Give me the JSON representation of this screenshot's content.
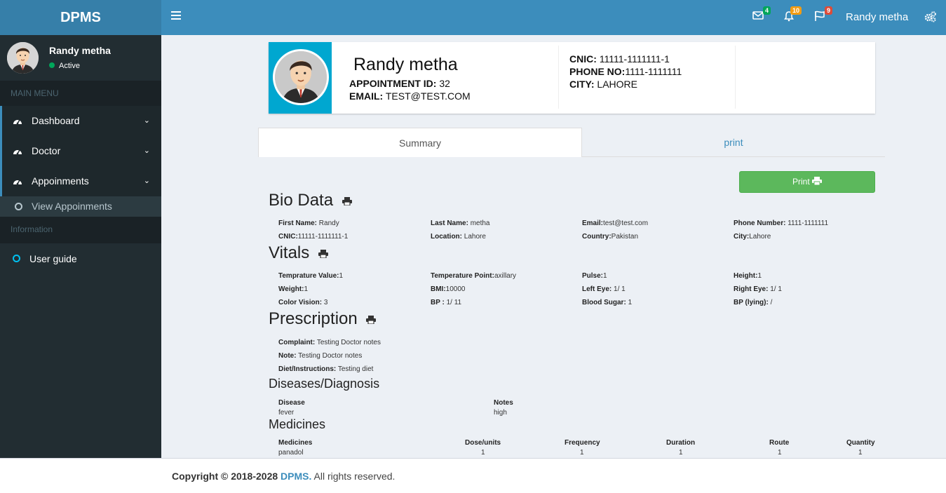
{
  "app": {
    "logo": "DPMS"
  },
  "topbar": {
    "messages_badge": "4",
    "notifications_badge": "10",
    "flags_badge": "9",
    "user_name": "Randy metha",
    "colors": {
      "bar": "#3c8dbc",
      "logo_bg": "#367fa9",
      "badge_green": "#00a65a",
      "badge_orange": "#f39c12",
      "badge_red": "#dd4b39"
    }
  },
  "sidebar": {
    "user_name": "Randy metha",
    "status": "Active",
    "main_header": "MAIN MENU",
    "items": [
      {
        "label": "Dashboard",
        "icon": "dashboard-icon"
      },
      {
        "label": "Doctor",
        "icon": "dashboard-icon"
      },
      {
        "label": "Appoinments",
        "icon": "dashboard-icon"
      }
    ],
    "sub_item": "View Appoinments",
    "info_header": "Information",
    "guide": "User guide"
  },
  "profile": {
    "name": "Randy metha",
    "appointment_label": "APPOINTMENT ID:",
    "appointment_id": "32",
    "email_label": "EMAIL:",
    "email": "TEST@TEST.COM",
    "cnic_label": "CNIC:",
    "cnic": "11111-1111111-1",
    "phone_label": "PHONE NO:",
    "phone": "1111-1111111",
    "city_label": "CITY:",
    "city": "LAHORE"
  },
  "tabs": {
    "summary": "Summary",
    "print": "print"
  },
  "print_button": "Print",
  "bio": {
    "title": "Bio Data",
    "first_name_label": "First Name:",
    "first_name": "Randy",
    "last_name_label": "Last Name:",
    "last_name": "metha",
    "email_label": "Email:",
    "email": "test@test.com",
    "phone_label": "Phone Number:",
    "phone": "1111-1111111",
    "cnic_label": "CNIC:",
    "cnic": "11111-1111111-1",
    "location_label": "Location:",
    "location": "Lahore",
    "country_label": "Country:",
    "country": "Pakistan",
    "city_label": "City:",
    "city": "Lahore"
  },
  "vitals": {
    "title": "Vitals",
    "temp_value_label": "Temprature Value:",
    "temp_value": "1",
    "temp_point_label": "Temperature Point:",
    "temp_point": "axillary",
    "pulse_label": "Pulse:",
    "pulse": "1",
    "height_label": "Height:",
    "height": "1",
    "weight_label": "Weight:",
    "weight": "1",
    "bmi_label": "BMI:",
    "bmi": "10000",
    "left_eye_label": "Left Eye:",
    "left_eye": "1/ 1",
    "right_eye_label": "Right Eye:",
    "right_eye": "1/ 1",
    "color_vision_label": "Color Vision:",
    "color_vision": "3",
    "bp_label": "BP :",
    "bp": "1/ 11",
    "blood_sugar_label": "Blood Sugar:",
    "blood_sugar": "1",
    "bp_lying_label": "BP (lying):",
    "bp_lying": "/"
  },
  "prescription": {
    "title": "Prescription",
    "complaint_label": "Complaint:",
    "complaint": "Testing Doctor notes",
    "note_label": "Note:",
    "note": "Testing Doctor notes",
    "diet_label": "Diet/Instructions:",
    "diet": "Testing diet"
  },
  "diseases": {
    "title": "Diseases/Diagnosis",
    "col_disease": "Disease",
    "col_notes": "Notes",
    "disease": "fever",
    "notes": "high"
  },
  "medicines": {
    "title": "Medicines",
    "headers": [
      "Medicines",
      "Dose/units",
      "Frequency",
      "Duration",
      "Route",
      "Quantity"
    ],
    "row": [
      "panadol",
      "1",
      "1",
      "1",
      "1",
      "1"
    ]
  },
  "footer": {
    "copyright": "Copyright © 2018-2028",
    "brand": "DPMS.",
    "rights": "All rights reserved."
  }
}
